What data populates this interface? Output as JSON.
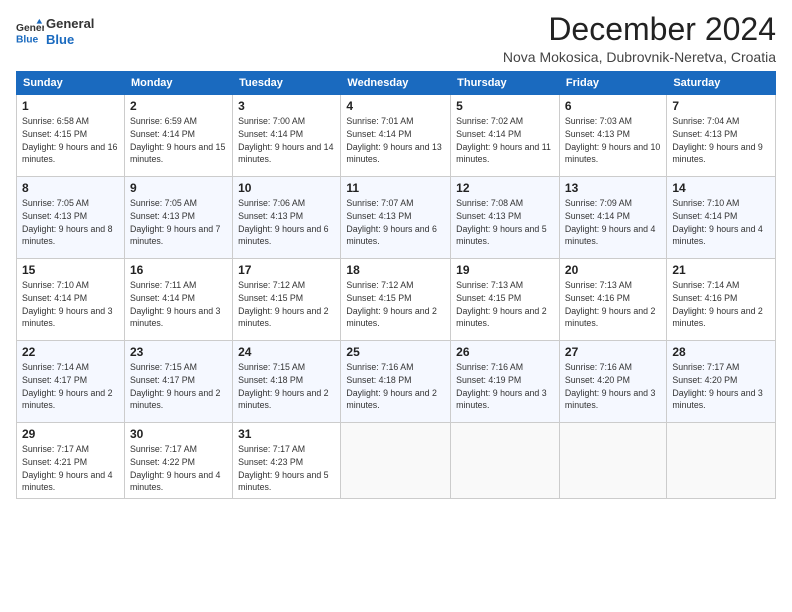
{
  "header": {
    "logo_line1": "General",
    "logo_line2": "Blue",
    "month": "December 2024",
    "location": "Nova Mokosica, Dubrovnik-Neretva, Croatia"
  },
  "days_of_week": [
    "Sunday",
    "Monday",
    "Tuesday",
    "Wednesday",
    "Thursday",
    "Friday",
    "Saturday"
  ],
  "weeks": [
    [
      {
        "day": "1",
        "sunrise": "6:58 AM",
        "sunset": "4:15 PM",
        "daylight": "9 hours and 16 minutes."
      },
      {
        "day": "2",
        "sunrise": "6:59 AM",
        "sunset": "4:14 PM",
        "daylight": "9 hours and 15 minutes."
      },
      {
        "day": "3",
        "sunrise": "7:00 AM",
        "sunset": "4:14 PM",
        "daylight": "9 hours and 14 minutes."
      },
      {
        "day": "4",
        "sunrise": "7:01 AM",
        "sunset": "4:14 PM",
        "daylight": "9 hours and 13 minutes."
      },
      {
        "day": "5",
        "sunrise": "7:02 AM",
        "sunset": "4:14 PM",
        "daylight": "9 hours and 11 minutes."
      },
      {
        "day": "6",
        "sunrise": "7:03 AM",
        "sunset": "4:13 PM",
        "daylight": "9 hours and 10 minutes."
      },
      {
        "day": "7",
        "sunrise": "7:04 AM",
        "sunset": "4:13 PM",
        "daylight": "9 hours and 9 minutes."
      }
    ],
    [
      {
        "day": "8",
        "sunrise": "7:05 AM",
        "sunset": "4:13 PM",
        "daylight": "9 hours and 8 minutes."
      },
      {
        "day": "9",
        "sunrise": "7:05 AM",
        "sunset": "4:13 PM",
        "daylight": "9 hours and 7 minutes."
      },
      {
        "day": "10",
        "sunrise": "7:06 AM",
        "sunset": "4:13 PM",
        "daylight": "9 hours and 6 minutes."
      },
      {
        "day": "11",
        "sunrise": "7:07 AM",
        "sunset": "4:13 PM",
        "daylight": "9 hours and 6 minutes."
      },
      {
        "day": "12",
        "sunrise": "7:08 AM",
        "sunset": "4:13 PM",
        "daylight": "9 hours and 5 minutes."
      },
      {
        "day": "13",
        "sunrise": "7:09 AM",
        "sunset": "4:14 PM",
        "daylight": "9 hours and 4 minutes."
      },
      {
        "day": "14",
        "sunrise": "7:10 AM",
        "sunset": "4:14 PM",
        "daylight": "9 hours and 4 minutes."
      }
    ],
    [
      {
        "day": "15",
        "sunrise": "7:10 AM",
        "sunset": "4:14 PM",
        "daylight": "9 hours and 3 minutes."
      },
      {
        "day": "16",
        "sunrise": "7:11 AM",
        "sunset": "4:14 PM",
        "daylight": "9 hours and 3 minutes."
      },
      {
        "day": "17",
        "sunrise": "7:12 AM",
        "sunset": "4:15 PM",
        "daylight": "9 hours and 2 minutes."
      },
      {
        "day": "18",
        "sunrise": "7:12 AM",
        "sunset": "4:15 PM",
        "daylight": "9 hours and 2 minutes."
      },
      {
        "day": "19",
        "sunrise": "7:13 AM",
        "sunset": "4:15 PM",
        "daylight": "9 hours and 2 minutes."
      },
      {
        "day": "20",
        "sunrise": "7:13 AM",
        "sunset": "4:16 PM",
        "daylight": "9 hours and 2 minutes."
      },
      {
        "day": "21",
        "sunrise": "7:14 AM",
        "sunset": "4:16 PM",
        "daylight": "9 hours and 2 minutes."
      }
    ],
    [
      {
        "day": "22",
        "sunrise": "7:14 AM",
        "sunset": "4:17 PM",
        "daylight": "9 hours and 2 minutes."
      },
      {
        "day": "23",
        "sunrise": "7:15 AM",
        "sunset": "4:17 PM",
        "daylight": "9 hours and 2 minutes."
      },
      {
        "day": "24",
        "sunrise": "7:15 AM",
        "sunset": "4:18 PM",
        "daylight": "9 hours and 2 minutes."
      },
      {
        "day": "25",
        "sunrise": "7:16 AM",
        "sunset": "4:18 PM",
        "daylight": "9 hours and 2 minutes."
      },
      {
        "day": "26",
        "sunrise": "7:16 AM",
        "sunset": "4:19 PM",
        "daylight": "9 hours and 3 minutes."
      },
      {
        "day": "27",
        "sunrise": "7:16 AM",
        "sunset": "4:20 PM",
        "daylight": "9 hours and 3 minutes."
      },
      {
        "day": "28",
        "sunrise": "7:17 AM",
        "sunset": "4:20 PM",
        "daylight": "9 hours and 3 minutes."
      }
    ],
    [
      {
        "day": "29",
        "sunrise": "7:17 AM",
        "sunset": "4:21 PM",
        "daylight": "9 hours and 4 minutes."
      },
      {
        "day": "30",
        "sunrise": "7:17 AM",
        "sunset": "4:22 PM",
        "daylight": "9 hours and 4 minutes."
      },
      {
        "day": "31",
        "sunrise": "7:17 AM",
        "sunset": "4:23 PM",
        "daylight": "9 hours and 5 minutes."
      },
      null,
      null,
      null,
      null
    ]
  ]
}
